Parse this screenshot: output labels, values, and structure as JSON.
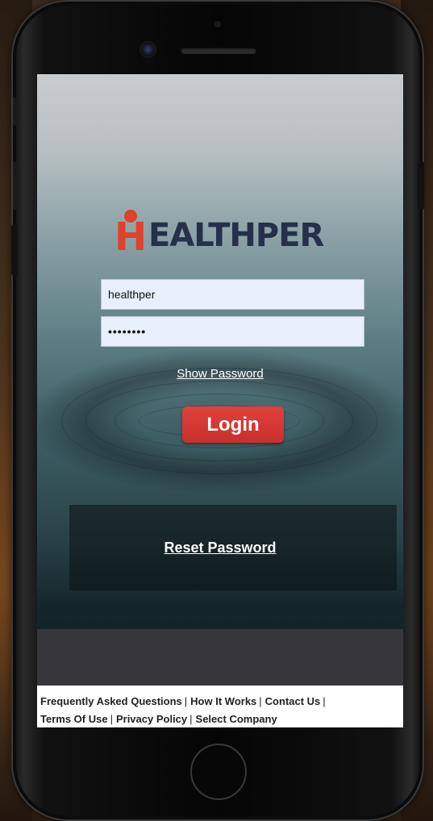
{
  "app": {
    "brand_mark": "H",
    "brand_text": "EALTHPER"
  },
  "login_form": {
    "username_value": "healthper",
    "password_value": "••••••••",
    "show_password_label": "Show Password",
    "login_label": "Login",
    "reset_password_label": "Reset Password"
  },
  "footer": {
    "row1": [
      "Frequently Asked Questions",
      "How It Works",
      "Contact Us"
    ],
    "row2": [
      "Terms Of Use",
      "Privacy Policy",
      "Select Company"
    ],
    "separator": "|"
  },
  "colors": {
    "brand_red": "#e0412b",
    "brand_navy": "#26304a",
    "login_button": "#c9302c",
    "input_bg": "#e8f0fe"
  }
}
